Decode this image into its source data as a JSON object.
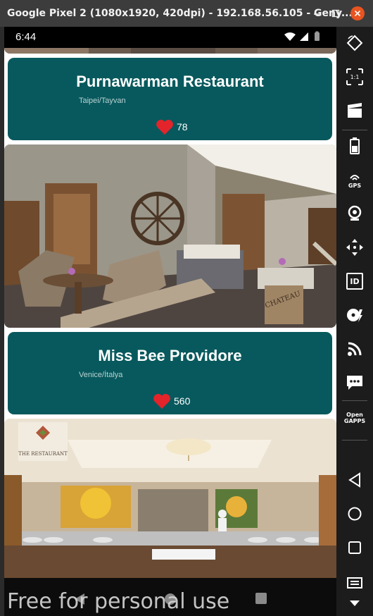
{
  "window": {
    "title": "Google Pixel 2 (1080x1920, 420dpi) - 192.168.56.105 - Geny...",
    "minimize_icon": "minimize-icon",
    "maximize_icon": "maximize-icon",
    "close_icon": "close-icon"
  },
  "statusbar": {
    "time": "6:44",
    "icons": [
      "wifi-icon",
      "signal-icon",
      "battery-icon"
    ]
  },
  "restaurants": [
    {
      "name": "Purnawarman Restaurant",
      "location": "Taipei/Tayvan",
      "likes": "78"
    },
    {
      "name": "Miss Bee Providore",
      "location": "Venice/İtalya",
      "likes": "560"
    }
  ],
  "image_texts": {
    "restaurant_logo": "THE RESTAURANT",
    "sign": "CHATEAU"
  },
  "watermark": "Free for personal use",
  "toolbar": {
    "gps_label": "GPS",
    "id_label": "ID",
    "open_gapps_label": "Open\nGAPPS",
    "ratio_label": "1:1"
  },
  "colors": {
    "card_bg": "#08595d",
    "heart": "#e3242b",
    "window_close": "#e95420"
  }
}
